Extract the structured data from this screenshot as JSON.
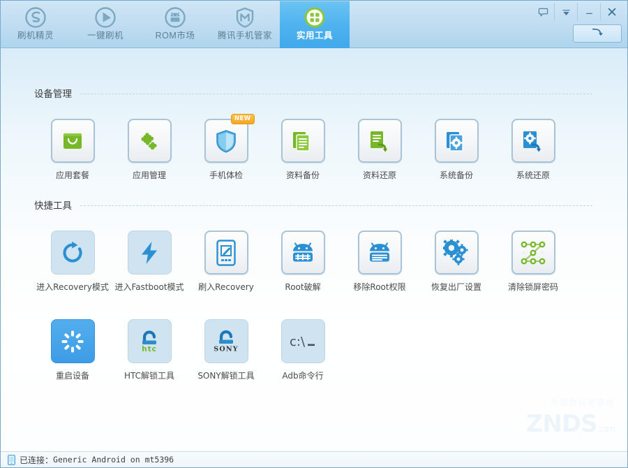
{
  "window": {
    "controls": [
      {
        "name": "feedback-button",
        "glyph": "speech-bubble-icon",
        "title": "反馈"
      },
      {
        "name": "menu-button",
        "glyph": "chevron-down-icon",
        "title": "菜单"
      },
      {
        "name": "minimize-button",
        "glyph": "minimize-icon",
        "title": "最小化"
      },
      {
        "name": "close-button",
        "glyph": "close-icon",
        "title": "关闭"
      }
    ],
    "refresh_button": {
      "name": "refresh-button",
      "glyph": "refresh-arrow-icon",
      "title": "刷新"
    }
  },
  "tabs": [
    {
      "label": "刷机精灵",
      "icon": "shuaji-logo-icon",
      "active": false
    },
    {
      "label": "一键刷机",
      "icon": "play-circle-icon",
      "active": false
    },
    {
      "label": "ROM市场",
      "icon": "android-circle-icon",
      "active": false
    },
    {
      "label": "腾讯手机管家",
      "icon": "shield-m-icon",
      "active": false
    },
    {
      "label": "实用工具",
      "icon": "grid-circle-icon",
      "active": true
    }
  ],
  "sections": [
    {
      "title": "设备管理",
      "rows": [
        [
          {
            "label": "应用套餐",
            "icon": "shopping-bag-icon",
            "style": "normal",
            "badge": null
          },
          {
            "label": "应用管理",
            "icon": "puzzle-piece-icon",
            "style": "normal",
            "badge": null
          },
          {
            "label": "手机体检",
            "icon": "shield-check-icon",
            "style": "normal",
            "badge": "NEW"
          },
          {
            "label": "资料备份",
            "icon": "documents-copy-icon",
            "style": "normal",
            "badge": null
          },
          {
            "label": "资料还原",
            "icon": "document-restore-icon",
            "style": "normal",
            "badge": null
          },
          {
            "label": "系统备份",
            "icon": "system-backup-icon",
            "style": "normal",
            "badge": null
          },
          {
            "label": "系统还原",
            "icon": "system-restore-icon",
            "style": "normal",
            "badge": null
          }
        ]
      ]
    },
    {
      "title": "快捷工具",
      "rows": [
        [
          {
            "label": "进入Recovery模式",
            "icon": "reboot-recovery-icon",
            "style": "flat",
            "badge": null
          },
          {
            "label": "进入Fastboot模式",
            "icon": "lightning-bolt-icon",
            "style": "flat",
            "badge": null
          },
          {
            "label": "刷入Recovery",
            "icon": "phone-pencil-icon",
            "style": "normal",
            "badge": null
          },
          {
            "label": "Root破解",
            "icon": "android-root-icon",
            "style": "normal",
            "badge": null
          },
          {
            "label": "移除Root权限",
            "icon": "android-unroot-icon",
            "style": "normal",
            "badge": null
          },
          {
            "label": "恢复出厂设置",
            "icon": "gears-icon",
            "style": "normal",
            "badge": null
          },
          {
            "label": "清除锁屏密码",
            "icon": "pattern-lock-icon",
            "style": "normal",
            "badge": null
          }
        ],
        [
          {
            "label": "重启设备",
            "icon": "reboot-sun-icon",
            "style": "solid",
            "badge": null
          },
          {
            "label": "HTC解锁工具",
            "icon": "htc-unlock-icon",
            "style": "flat",
            "badge": null
          },
          {
            "label": "SONY解锁工具",
            "icon": "sony-unlock-icon",
            "style": "flat",
            "badge": null
          },
          {
            "label": "Adb命令行",
            "icon": "adb-console-icon",
            "style": "flat",
            "badge": null
          }
        ]
      ]
    }
  ],
  "watermark": {
    "top": "中国数码资源网",
    "main": "ZNDS",
    "sub": ".com"
  },
  "statusbar": {
    "icon": "phone-icon",
    "prefix": "已连接：",
    "device": "Generic Android on mt5396"
  },
  "colors": {
    "accent": "#3c9ce6",
    "tab_active": "#4fb3ef",
    "green": "#76b82a",
    "blue_icon": "#2b8fd4",
    "badge_orange": "#f5a623",
    "text": "#4a4a4a"
  }
}
